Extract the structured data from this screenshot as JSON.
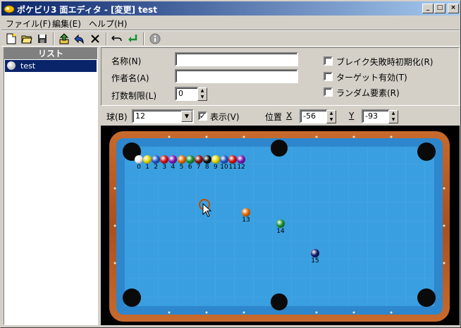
{
  "window": {
    "title": "ポケビリ3 面エディタ - [変更] test",
    "minimize": "_",
    "maximize": "□",
    "close": "×"
  },
  "menu": {
    "items": [
      "ファイル(F)",
      "編集(E)",
      "ヘルプ(H)"
    ]
  },
  "toolbar": {
    "icons": [
      "new-file-icon",
      "open-folder-icon",
      "save-icon",
      "upload-icon",
      "back-arrow-icon",
      "delete-icon",
      "undo-icon",
      "enter-icon",
      "info-icon"
    ]
  },
  "list": {
    "header": "リスト",
    "items": [
      {
        "label": "test",
        "selected": true
      }
    ]
  },
  "props": {
    "name_label": "名称(N)",
    "name_value": "",
    "author_label": "作者名(A)",
    "author_value": "",
    "shots_label": "打数制限(L)",
    "shots_value": "0",
    "checks": [
      {
        "label": "ブレイク失敗時初期化(R)",
        "checked": false
      },
      {
        "label": "ターゲット有効(T)",
        "checked": false
      },
      {
        "label": "ランダム要素(R)",
        "checked": false
      }
    ]
  },
  "controls": {
    "ball_label": "球(B)",
    "ball_value": "12",
    "show_label": "表示(V)",
    "show_checked": true,
    "pos_label": "位置",
    "x_label": "X",
    "x_value": "-56",
    "y_label": "Y",
    "y_value": "-93"
  },
  "balls": {
    "rack": [
      {
        "num": "0",
        "color": "#f0f0f0"
      },
      {
        "num": "1",
        "color": "#e8d800"
      },
      {
        "num": "2",
        "color": "#1f57c8"
      },
      {
        "num": "3",
        "color": "#d01010"
      },
      {
        "num": "4",
        "color": "#7a18b8"
      },
      {
        "num": "5",
        "color": "#e86a00"
      },
      {
        "num": "6",
        "color": "#189030"
      },
      {
        "num": "7",
        "color": "#8a1010"
      },
      {
        "num": "8",
        "color": "#101010"
      },
      {
        "num": "9",
        "color": "#e8d800"
      },
      {
        "num": "10",
        "color": "#1f57c8"
      },
      {
        "num": "11",
        "color": "#d01010"
      },
      {
        "num": "12",
        "color": "#7a18b8"
      }
    ],
    "placed": [
      {
        "num": "13",
        "color": "#e86a00"
      },
      {
        "num": "14",
        "color": "#189030"
      },
      {
        "num": "15",
        "color": "#1a1a6a"
      }
    ]
  },
  "colors": {
    "felt": "#3a9fe0",
    "rail": "#b85a22",
    "cushion": "#2e86cc",
    "selection": "#0a246a"
  }
}
